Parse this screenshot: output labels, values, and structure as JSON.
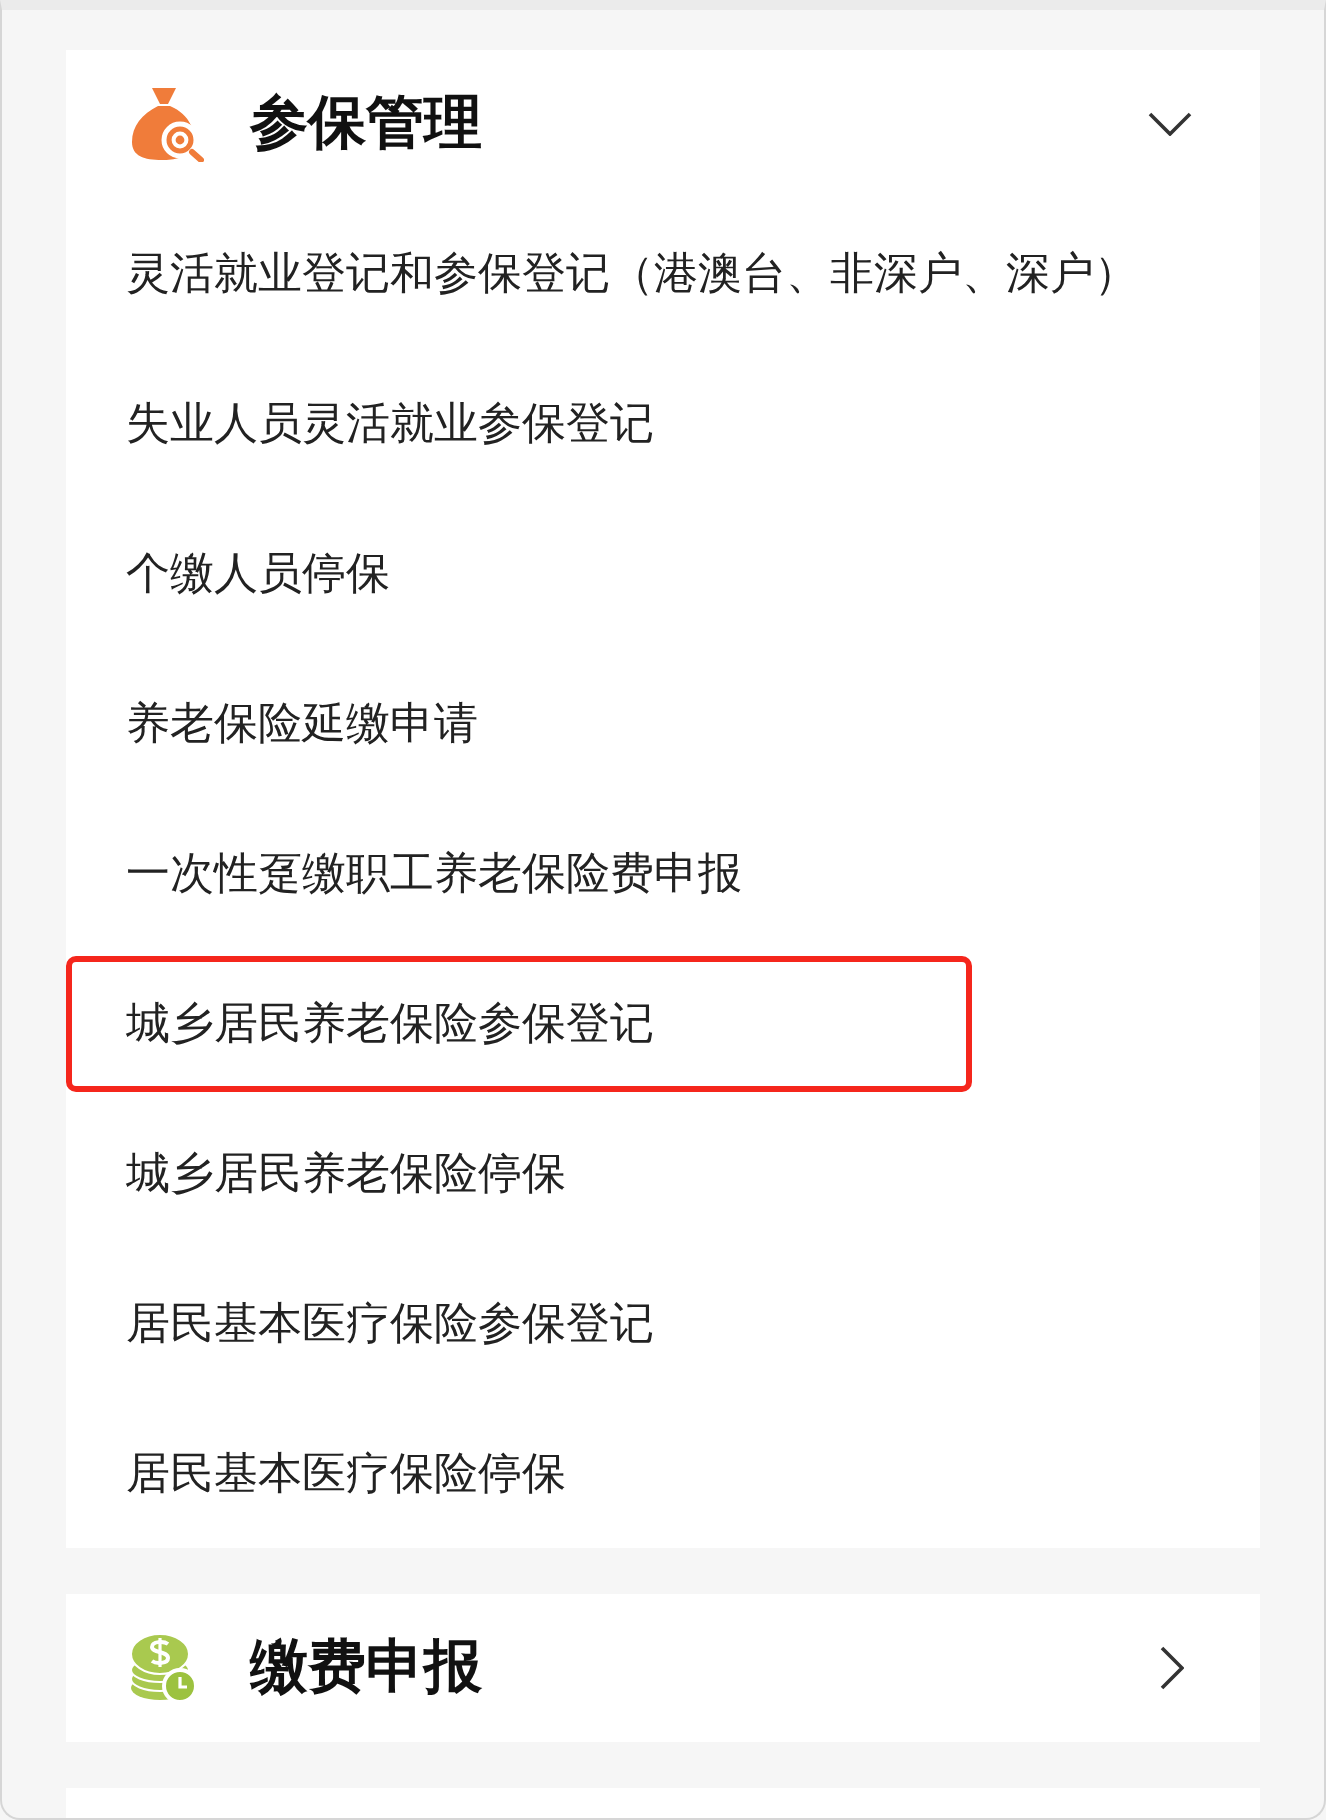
{
  "sections": [
    {
      "title": "参保管理",
      "expanded": true,
      "items": [
        {
          "label": "灵活就业登记和参保登记（港澳台、非深户、深户）",
          "highlighted": false
        },
        {
          "label": "失业人员灵活就业参保登记",
          "highlighted": false
        },
        {
          "label": "个缴人员停保",
          "highlighted": false
        },
        {
          "label": "养老保险延缴申请",
          "highlighted": false
        },
        {
          "label": "一次性趸缴职工养老保险费申报",
          "highlighted": false
        },
        {
          "label": "城乡居民养老保险参保登记",
          "highlighted": true
        },
        {
          "label": "城乡居民养老保险停保",
          "highlighted": false
        },
        {
          "label": "居民基本医疗保险参保登记",
          "highlighted": false
        },
        {
          "label": "居民基本医疗保险停保",
          "highlighted": false
        }
      ]
    },
    {
      "title": "缴费申报",
      "expanded": false
    }
  ]
}
